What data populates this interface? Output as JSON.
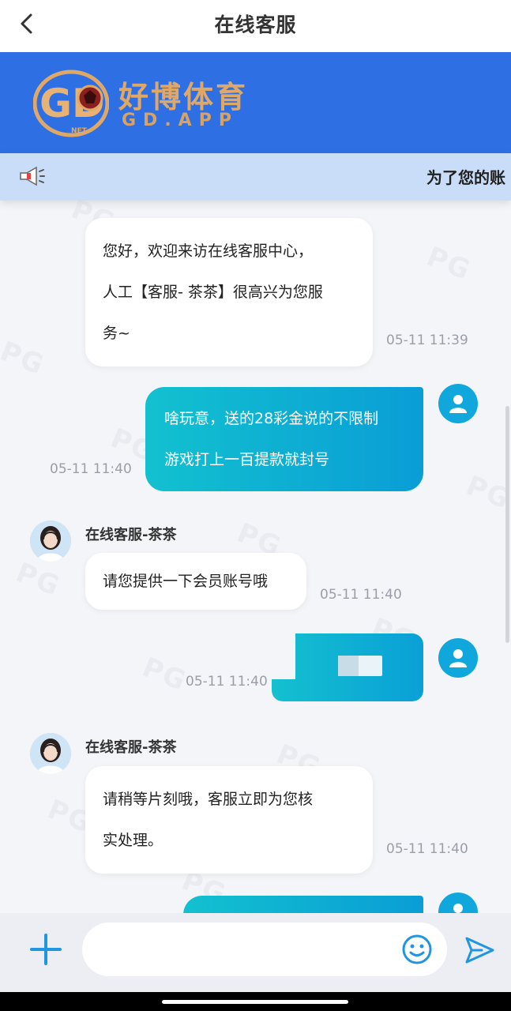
{
  "header": {
    "title": "在线客服",
    "back_icon": "chevron-left-icon"
  },
  "banner": {
    "brand_name": "好博体育",
    "brand_domain": "GD.APP",
    "logo_letters": "GD",
    "logo_sub": "NET",
    "bg_color": "#2e6fe3",
    "gold_color": "#e0a867"
  },
  "notice": {
    "icon": "megaphone-icon",
    "text": "为了您的账"
  },
  "messages": [
    {
      "side": "in",
      "lines": [
        "您好，欢迎来访在线客服中心，",
        "人工【客服- 茶茶】很高兴为您服",
        "务~"
      ],
      "time": "05-11 11:39"
    },
    {
      "side": "out",
      "lines": [
        "啥玩意，送的28彩金说的不限制",
        "游戏打上一百提款就封号"
      ],
      "time": "05-11 11:40"
    },
    {
      "side": "in",
      "agent": "在线客服-茶茶",
      "lines": [
        "请您提供一下会员账号哦"
      ],
      "time": "05-11 11:40"
    },
    {
      "side": "out",
      "type": "image",
      "time": "05-11 11:40"
    },
    {
      "side": "in",
      "agent": "在线客服-茶茶",
      "lines": [
        "请稍等片刻哦，客服立即为您核",
        "实处理。"
      ],
      "time": "05-11 11:40"
    },
    {
      "side": "out",
      "type": "partial"
    }
  ],
  "watermark": "PG",
  "composer": {
    "placeholder": "",
    "plus_icon": "plus-icon",
    "emoji_icon": "emoji-icon",
    "send_icon": "send-icon",
    "accent_color": "#2196e0"
  }
}
